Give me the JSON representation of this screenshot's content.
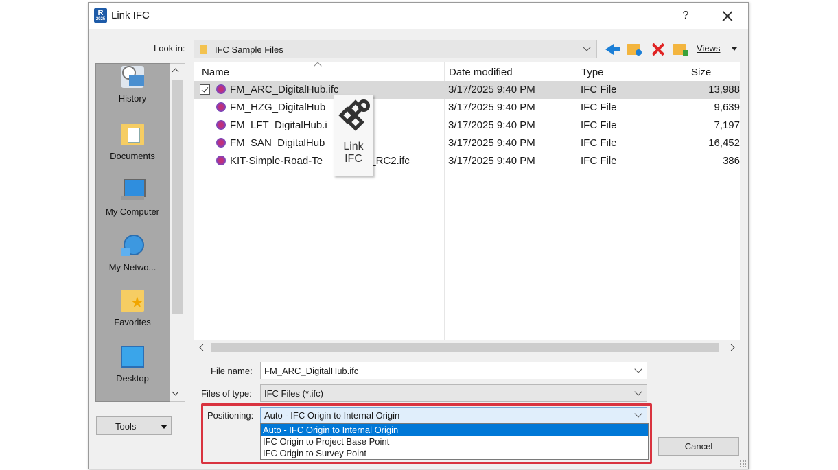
{
  "window": {
    "title": "Link IFC",
    "help": "?",
    "app_icon": "R"
  },
  "toolbar": {
    "look_in_label": "Look in:",
    "look_in_value": "IFC Sample Files",
    "icons": [
      "back-arrow-icon",
      "up-folder-icon",
      "delete-icon",
      "new-folder-icon"
    ],
    "views_label": "Views"
  },
  "places": [
    {
      "label": "History",
      "icon": "history-icon"
    },
    {
      "label": "Documents",
      "icon": "documents-icon"
    },
    {
      "label": "My Computer",
      "icon": "my-computer-icon"
    },
    {
      "label": "My Netwo...",
      "icon": "network-icon"
    },
    {
      "label": "Favorites",
      "icon": "favorites-icon"
    },
    {
      "label": "Desktop",
      "icon": "desktop-icon"
    }
  ],
  "tools_label": "Tools",
  "columns": {
    "name": "Name",
    "date": "Date modified",
    "type": "Type",
    "size": "Size"
  },
  "files": [
    {
      "name": "FM_ARC_DigitalHub.ifc",
      "date": "3/17/2025 9:40 PM",
      "type": "IFC File",
      "size": "13,988",
      "selected": true
    },
    {
      "name": "FM_HZG_DigitalHub",
      "date": "3/17/2025 9:40 PM",
      "type": "IFC File",
      "size": "9,639",
      "selected": false
    },
    {
      "name": "FM_LFT_DigitalHub.i",
      "date": "3/17/2025 9:40 PM",
      "type": "IFC File",
      "size": "7,197",
      "selected": false
    },
    {
      "name": "FM_SAN_DigitalHub",
      "date": "3/17/2025 9:40 PM",
      "type": "IFC File",
      "size": "16,452",
      "selected": false
    },
    {
      "name": "KIT-Simple-Road-Te      FC4x3_RC2.ifc",
      "date": "3/17/2025 9:40 PM",
      "type": "IFC File",
      "size": "386",
      "selected": false
    }
  ],
  "tooltip": {
    "line1": "Link",
    "line2": "IFC"
  },
  "form": {
    "file_name_label": "File name:",
    "file_name_value": "FM_ARC_DigitalHub.ifc",
    "files_of_type_label": "Files of type:",
    "files_of_type_value": "IFC Files (*.ifc)",
    "positioning_label": "Positioning:",
    "positioning_value": "Auto - IFC Origin to Internal Origin",
    "positioning_options": [
      "Auto - IFC Origin to Internal Origin",
      "IFC Origin to Project Base Point",
      "IFC Origin to Survey Point"
    ]
  },
  "cancel_label": "Cancel",
  "colors": {
    "highlight": "#0078d7",
    "callout": "#d9333f",
    "places_bg": "#a8a8a8"
  }
}
